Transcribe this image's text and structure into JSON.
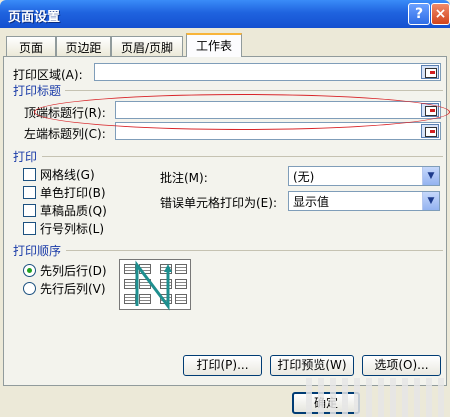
{
  "window": {
    "title": "页面设置",
    "help_label": "?",
    "close_label": "×"
  },
  "tabs": [
    {
      "label": "页面"
    },
    {
      "label": "页边距"
    },
    {
      "label": "页眉/页脚"
    },
    {
      "label": "工作表"
    }
  ],
  "print_area": {
    "label": "打印区域(A):",
    "value": ""
  },
  "print_titles": {
    "header": "打印标题",
    "top_rows_label": "顶端标题行(R):",
    "left_cols_label": "左端标题列(C):",
    "top_rows_value": "",
    "left_cols_value": ""
  },
  "print": {
    "header": "打印",
    "gridlines": "网格线(G)",
    "mono": "单色打印(B)",
    "draft": "草稿品质(Q)",
    "row_col_headers": "行号列标(L)",
    "comments_label": "批注(M):",
    "comments_value": "(无)",
    "errors_label": "错误单元格打印为(E):",
    "errors_value": "显示值"
  },
  "page_order": {
    "header": "打印顺序",
    "down_then_over": "先列后行(D)",
    "over_then_down": "先行后列(V)",
    "selected": "down_then_over"
  },
  "buttons": {
    "print": "打印(P)...",
    "preview": "打印预览(W)",
    "options": "选项(O)...",
    "ok": "确定"
  },
  "colors": {
    "titlebar": "#1f63df",
    "annotation": "#d8262a",
    "group_header": "#1a3ba8"
  }
}
